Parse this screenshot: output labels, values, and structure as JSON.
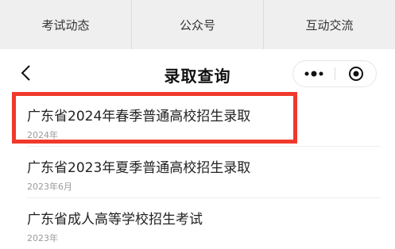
{
  "tabs": [
    "考试动态",
    "公众号",
    "互动交流"
  ],
  "nav": {
    "title": "录取查询",
    "back_icon": "chevron-left-icon",
    "more_icon": "more-dots-icon",
    "close_icon": "target-circle-icon"
  },
  "items": [
    {
      "title": "广东省2024年春季普通高校招生录取",
      "date": "2024年"
    },
    {
      "title": "广东省2023年夏季普通高校招生录取",
      "date": "2023年6月"
    },
    {
      "title": "广东省成人高等学校招生考试",
      "date": "2023年"
    }
  ],
  "colors": {
    "tabbar_bg": "#efefef",
    "highlight": "#f0392c",
    "text_secondary": "#9a9a9a"
  }
}
